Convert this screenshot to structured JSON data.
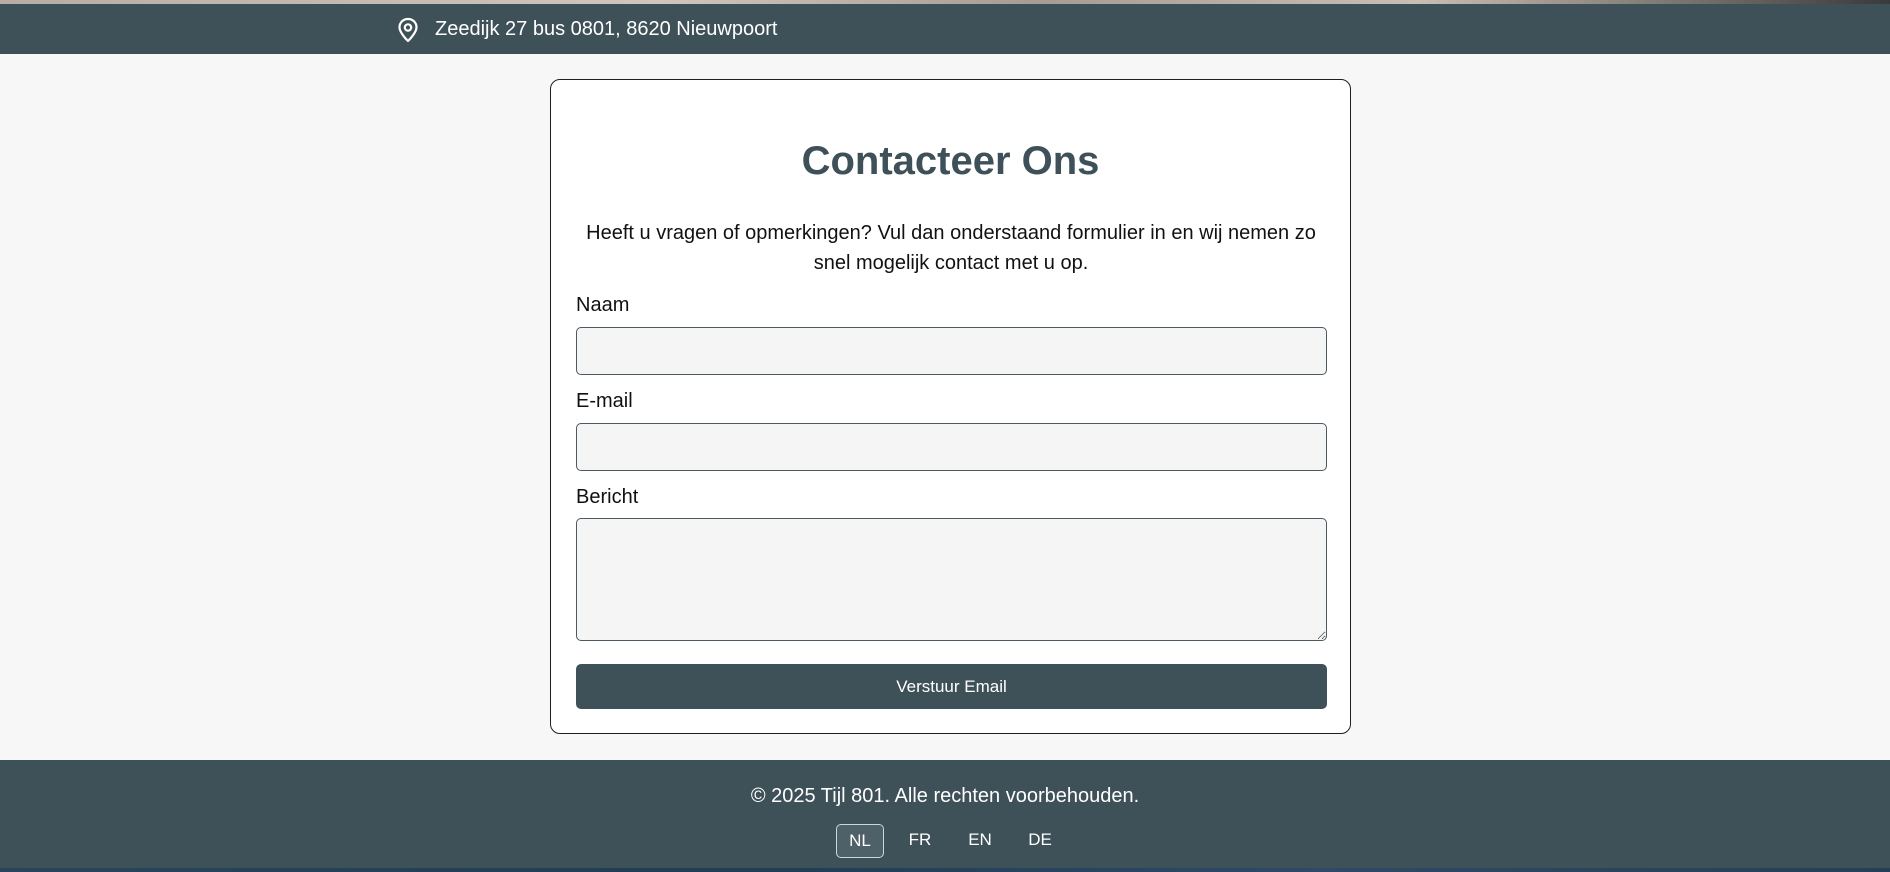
{
  "address_bar": {
    "icon": "map-pin-icon",
    "address": "Zeedijk 27 bus 0801, 8620 Nieuwpoort"
  },
  "contact": {
    "title": "Contacteer Ons",
    "intro": "Heeft u vragen of opmerkingen? Vul dan onderstaand formulier in en wij nemen zo snel mogelijk contact met u op.",
    "fields": {
      "name_label": "Naam",
      "name_value": "",
      "email_label": "E-mail",
      "email_value": "",
      "message_label": "Bericht",
      "message_value": ""
    },
    "submit_label": "Verstuur Email"
  },
  "footer": {
    "copyright": "© 2025 Tijl 801. Alle rechten voorbehouden.",
    "languages": [
      {
        "code": "NL",
        "active": true
      },
      {
        "code": "FR",
        "active": false
      },
      {
        "code": "EN",
        "active": false
      },
      {
        "code": "DE",
        "active": false
      }
    ]
  },
  "colors": {
    "primary": "#3e5058",
    "background": "#f7f7f7",
    "input_background": "#f5f5f5",
    "text": "#111111"
  }
}
